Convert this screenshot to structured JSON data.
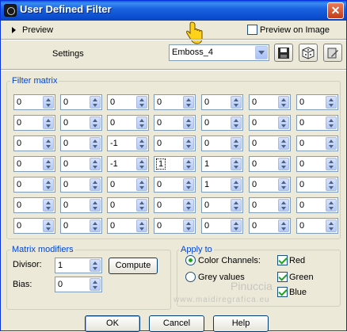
{
  "window": {
    "title": "User Defined Filter",
    "close_glyph": "✕"
  },
  "preview": {
    "label": "Preview",
    "preview_on_image": "Preview on Image",
    "preview_on_image_checked": false
  },
  "settings": {
    "label": "Settings",
    "preset": "Emboss_4"
  },
  "toolbar": {
    "icons": [
      "save-preset-icon",
      "random-icon",
      "edit-preset-icon"
    ]
  },
  "matrix": {
    "title": "Filter matrix",
    "rows": [
      [
        "0",
        "0",
        "0",
        "0",
        "0",
        "0",
        "0"
      ],
      [
        "0",
        "0",
        "0",
        "0",
        "0",
        "0",
        "0"
      ],
      [
        "0",
        "0",
        "-1",
        "0",
        "0",
        "0",
        "0"
      ],
      [
        "0",
        "0",
        "-1",
        "1",
        "1",
        "0",
        "0"
      ],
      [
        "0",
        "0",
        "0",
        "0",
        "1",
        "0",
        "0"
      ],
      [
        "0",
        "0",
        "0",
        "0",
        "0",
        "0",
        "0"
      ],
      [
        "0",
        "0",
        "0",
        "0",
        "0",
        "0",
        "0"
      ]
    ]
  },
  "modifiers": {
    "title": "Matrix modifiers",
    "divisor_label": "Divisor:",
    "divisor_value": "1",
    "compute_label": "Compute",
    "bias_label": "Bias:",
    "bias_value": "0"
  },
  "apply_to": {
    "title": "Apply to",
    "color_channels_label": "Color Channels:",
    "grey_values_label": "Grey values",
    "selected": "color_channels",
    "red_label": "Red",
    "green_label": "Green",
    "blue_label": "Blue",
    "red_checked": true,
    "green_checked": true,
    "blue_checked": true
  },
  "buttons": {
    "ok": "OK",
    "cancel": "Cancel",
    "help": "Help"
  },
  "watermark": {
    "line1": "Pinuccia",
    "line2": "www.maidiregrafica.eu"
  },
  "colors": {
    "title_bar": "#0a5fd8",
    "group_title": "#0046d5",
    "check_green": "#21a121",
    "dialog_bg": "#ece9d8"
  }
}
